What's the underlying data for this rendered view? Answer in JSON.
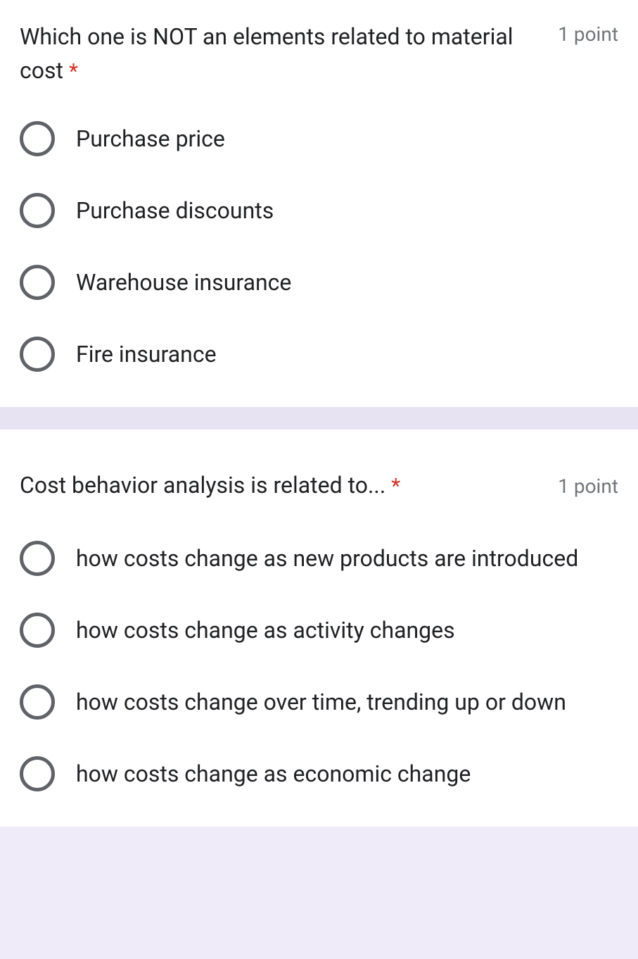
{
  "questions": [
    {
      "title": "Which one is NOT an elements related to material cost",
      "required_mark": "*",
      "points": "1 point",
      "options": [
        "Purchase price",
        "Purchase discounts",
        "Warehouse insurance",
        "Fire insurance"
      ]
    },
    {
      "title": "Cost behavior analysis is related to...",
      "required_mark": "*",
      "points": "1 point",
      "options": [
        "how costs change as new products are introduced",
        "how costs change as activity changes",
        "how costs change over time, trending up or down",
        "how costs change as economic change"
      ]
    }
  ]
}
